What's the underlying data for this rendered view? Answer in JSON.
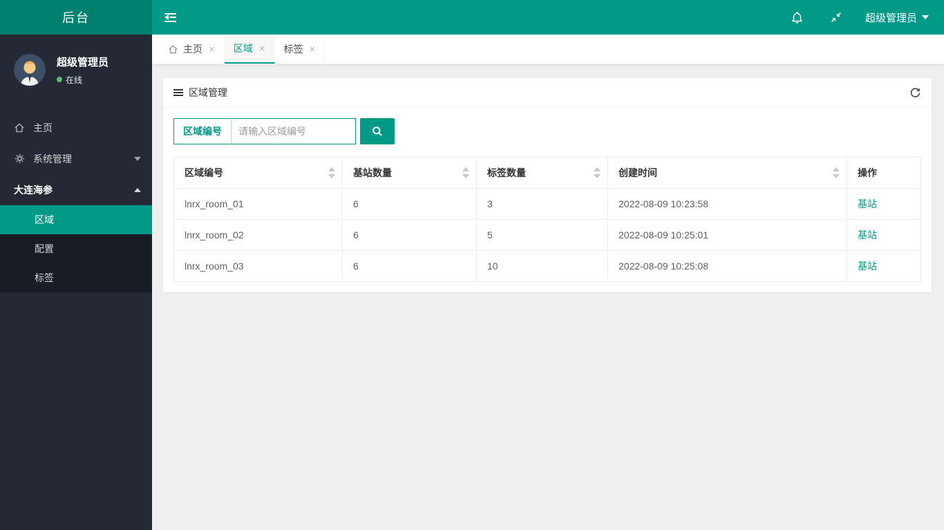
{
  "header": {
    "logo_text": "后台",
    "user_name": "超级管理员"
  },
  "sidebar": {
    "profile": {
      "name": "超级管理员",
      "status": "在线"
    },
    "menu": [
      {
        "label": "主页",
        "icon": "home-icon"
      },
      {
        "label": "系统管理",
        "icon": "gear-icon",
        "caret": "down"
      },
      {
        "label": "大连海参",
        "caret": "up"
      }
    ],
    "submenu": [
      {
        "label": "区域",
        "active": true
      },
      {
        "label": "配置",
        "active": false
      },
      {
        "label": "标签",
        "active": false
      }
    ]
  },
  "tabs": [
    {
      "label": "主页",
      "icon": "home-icon",
      "close": "×"
    },
    {
      "label": "区域",
      "close": "×",
      "active": true
    },
    {
      "label": "标签",
      "close": "×"
    }
  ],
  "panel": {
    "title": "区域管理",
    "search": {
      "field_label": "区域编号",
      "placeholder": "请输入区域编号"
    }
  },
  "table": {
    "columns": [
      "区域编号",
      "基站数量",
      "标签数量",
      "创建时间",
      "操作"
    ],
    "rows": [
      {
        "area_id": "lnrx_room_01",
        "stations": "6",
        "tags": "3",
        "created": "2022-08-09 10:23:58",
        "action": "基站"
      },
      {
        "area_id": "lnrx_room_02",
        "stations": "6",
        "tags": "5",
        "created": "2022-08-09 10:25:01",
        "action": "基站"
      },
      {
        "area_id": "lnrx_room_03",
        "stations": "6",
        "tags": "10",
        "created": "2022-08-09 10:25:08",
        "action": "基站"
      }
    ]
  },
  "icons": {
    "toggle": "collapse-sidebar",
    "bell": "notifications",
    "compress": "exit-fullscreen",
    "refresh": "reload-panel",
    "search": "magnifier",
    "online_dot": "online-status"
  },
  "colors": {
    "accent": "#019a89",
    "logo_bg": "#00806e",
    "sidebar_bg": "#232a33",
    "submenu_bg": "#181d25",
    "online_green": "#5fb878"
  }
}
